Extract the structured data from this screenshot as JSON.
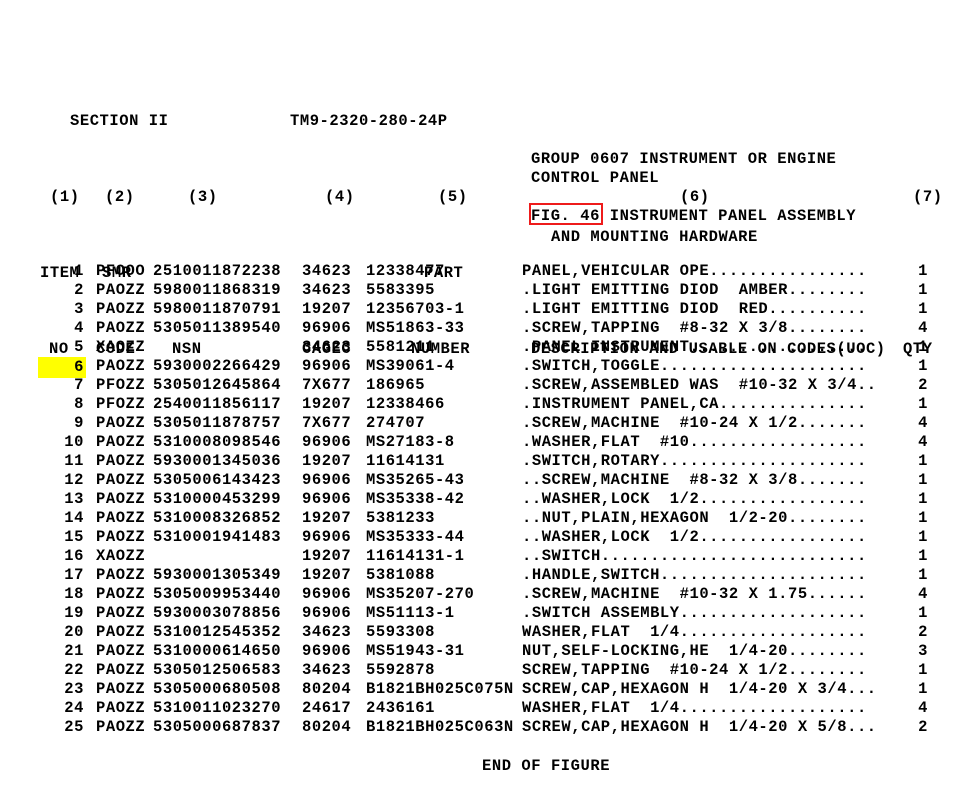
{
  "document": {
    "section": "SECTION II",
    "tm_number": "TM9-2320-280-24P",
    "end_of_figure": "END OF FIGURE"
  },
  "header": {
    "column_numbers": {
      "c1": "(1)",
      "c2": "(2)",
      "c3": "(3)",
      "c4": "(4)",
      "c5": "(5)",
      "c6": "(6)",
      "c7": "(7)"
    },
    "line_a": {
      "item": "ITEM",
      "smr": "SMR",
      "part": "PART"
    },
    "line_b": {
      "no": "NO",
      "code": "CODE",
      "nsn": "NSN",
      "cagec": "CAGEC",
      "number": "NUMBER",
      "description": "DESCRIPTION AND USABLE ON CODES(UOC)",
      "qty": "QTY"
    }
  },
  "group": {
    "title_line_1": "GROUP 0607 INSTRUMENT OR ENGINE",
    "title_line_2": "CONTROL PANEL"
  },
  "figure": {
    "title_line_1": "FIG. 46 INSTRUMENT PANEL ASSEMBLY",
    "title_line_2": "AND MOUNTING HARDWARE",
    "highlight_box_color": "#ee1b1b",
    "highlight_box_target": "FIG. 4"
  },
  "selection": {
    "highlight_color": "#ffff00",
    "highlighted_item_no": "6"
  },
  "rows": [
    {
      "item": "1",
      "smr": "PFOOO",
      "nsn": "2510011872238",
      "cagec": "34623",
      "part": "12338477",
      "desc": "PANEL,VEHICULAR OPE................",
      "qty": "1",
      "highlighted": false
    },
    {
      "item": "2",
      "smr": "PAOZZ",
      "nsn": "5980011868319",
      "cagec": "34623",
      "part": "5583395",
      "desc": ".LIGHT EMITTING DIOD  AMBER........",
      "qty": "1",
      "highlighted": false
    },
    {
      "item": "3",
      "smr": "PAOZZ",
      "nsn": "5980011870791",
      "cagec": "19207",
      "part": "12356703-1",
      "desc": ".LIGHT EMITTING DIOD  RED..........",
      "qty": "1",
      "highlighted": false
    },
    {
      "item": "4",
      "smr": "PAOZZ",
      "nsn": "5305011389540",
      "cagec": "96906",
      "part": "MS51863-33",
      "desc": ".SCREW,TAPPING  #8-32 X 3/8........",
      "qty": "4",
      "highlighted": false
    },
    {
      "item": "5",
      "smr": "XAOZZ",
      "nsn": "",
      "cagec": "34623",
      "part": "5581211",
      "desc": ".PANEL INSTRUMENT..................",
      "qty": "1",
      "highlighted": false
    },
    {
      "item": "6",
      "smr": "PAOZZ",
      "nsn": "5930002266429",
      "cagec": "96906",
      "part": "MS39061-4",
      "desc": ".SWITCH,TOGGLE.....................",
      "qty": "1",
      "highlighted": true
    },
    {
      "item": "7",
      "smr": "PFOZZ",
      "nsn": "5305012645864",
      "cagec": "7X677",
      "part": "186965",
      "desc": ".SCREW,ASSEMBLED WAS  #10-32 X 3/4..",
      "qty": "2",
      "highlighted": false
    },
    {
      "item": "8",
      "smr": "PFOZZ",
      "nsn": "2540011856117",
      "cagec": "19207",
      "part": "12338466",
      "desc": ".INSTRUMENT PANEL,CA...............",
      "qty": "1",
      "highlighted": false
    },
    {
      "item": "9",
      "smr": "PAOZZ",
      "nsn": "5305011878757",
      "cagec": "7X677",
      "part": "274707",
      "desc": ".SCREW,MACHINE  #10-24 X 1/2.......",
      "qty": "4",
      "highlighted": false
    },
    {
      "item": "10",
      "smr": "PAOZZ",
      "nsn": "5310008098546",
      "cagec": "96906",
      "part": "MS27183-8",
      "desc": ".WASHER,FLAT  #10..................",
      "qty": "4",
      "highlighted": false
    },
    {
      "item": "11",
      "smr": "PAOZZ",
      "nsn": "5930001345036",
      "cagec": "19207",
      "part": "11614131",
      "desc": ".SWITCH,ROTARY.....................",
      "qty": "1",
      "highlighted": false
    },
    {
      "item": "12",
      "smr": "PAOZZ",
      "nsn": "5305006143423",
      "cagec": "96906",
      "part": "MS35265-43",
      "desc": "..SCREW,MACHINE  #8-32 X 3/8.......",
      "qty": "1",
      "highlighted": false
    },
    {
      "item": "13",
      "smr": "PAOZZ",
      "nsn": "5310000453299",
      "cagec": "96906",
      "part": "MS35338-42",
      "desc": "..WASHER,LOCK  1/2.................",
      "qty": "1",
      "highlighted": false
    },
    {
      "item": "14",
      "smr": "PAOZZ",
      "nsn": "5310008326852",
      "cagec": "19207",
      "part": "5381233",
      "desc": "..NUT,PLAIN,HEXAGON  1/2-20........",
      "qty": "1",
      "highlighted": false
    },
    {
      "item": "15",
      "smr": "PAOZZ",
      "nsn": "5310001941483",
      "cagec": "96906",
      "part": "MS35333-44",
      "desc": "..WASHER,LOCK  1/2.................",
      "qty": "1",
      "highlighted": false
    },
    {
      "item": "16",
      "smr": "XAOZZ",
      "nsn": "",
      "cagec": "19207",
      "part": "11614131-1",
      "desc": "..SWITCH...........................",
      "qty": "1",
      "highlighted": false
    },
    {
      "item": "17",
      "smr": "PAOZZ",
      "nsn": "5930001305349",
      "cagec": "19207",
      "part": "5381088",
      "desc": ".HANDLE,SWITCH.....................",
      "qty": "1",
      "highlighted": false
    },
    {
      "item": "18",
      "smr": "PAOZZ",
      "nsn": "5305009953440",
      "cagec": "96906",
      "part": "MS35207-270",
      "desc": ".SCREW,MACHINE  #10-32 X 1.75......",
      "qty": "4",
      "highlighted": false
    },
    {
      "item": "19",
      "smr": "PAOZZ",
      "nsn": "5930003078856",
      "cagec": "96906",
      "part": "MS51113-1",
      "desc": ".SWITCH ASSEMBLY...................",
      "qty": "1",
      "highlighted": false
    },
    {
      "item": "20",
      "smr": "PAOZZ",
      "nsn": "5310012545352",
      "cagec": "34623",
      "part": "5593308",
      "desc": "WASHER,FLAT  1/4...................",
      "qty": "2",
      "highlighted": false
    },
    {
      "item": "21",
      "smr": "PAOZZ",
      "nsn": "5310000614650",
      "cagec": "96906",
      "part": "MS51943-31",
      "desc": "NUT,SELF-LOCKING,HE  1/4-20........",
      "qty": "3",
      "highlighted": false
    },
    {
      "item": "22",
      "smr": "PAOZZ",
      "nsn": "5305012506583",
      "cagec": "34623",
      "part": "5592878",
      "desc": "SCREW,TAPPING  #10-24 X 1/2........",
      "qty": "1",
      "highlighted": false
    },
    {
      "item": "23",
      "smr": "PAOZZ",
      "nsn": "5305000680508",
      "cagec": "80204",
      "part": "B1821BH025C075N",
      "desc": "SCREW,CAP,HEXAGON H  1/4-20 X 3/4...",
      "qty": "1",
      "highlighted": false
    },
    {
      "item": "24",
      "smr": "PAOZZ",
      "nsn": "5310011023270",
      "cagec": "24617",
      "part": "2436161",
      "desc": "WASHER,FLAT  1/4...................",
      "qty": "4",
      "highlighted": false
    },
    {
      "item": "25",
      "smr": "PAOZZ",
      "nsn": "5305000687837",
      "cagec": "80204",
      "part": "B1821BH025C063N",
      "desc": "SCREW,CAP,HEXAGON H  1/4-20 X 5/8...",
      "qty": "2",
      "highlighted": false
    }
  ]
}
